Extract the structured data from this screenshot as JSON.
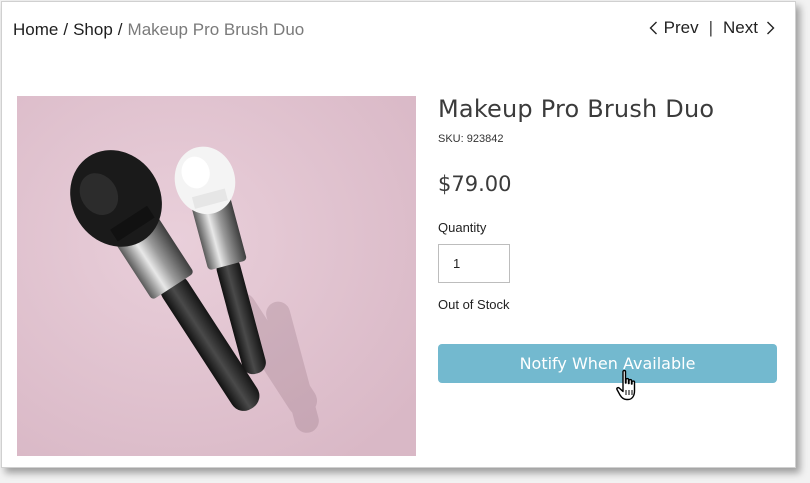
{
  "breadcrumb": {
    "home": "Home",
    "separator": "/",
    "shop": "Shop",
    "current": "Makeup Pro Brush Duo"
  },
  "pager": {
    "prev_label": "Prev",
    "divider": "|",
    "next_label": "Next"
  },
  "product": {
    "title": "Makeup Pro Brush Duo",
    "sku": "SKU: 923842",
    "price": "$79.00",
    "quantity_label": "Quantity",
    "quantity_value": "1",
    "stock_status": "Out of Stock",
    "notify_button_label": "Notify When Available",
    "image_icon": "makeup-brushes-photo"
  },
  "colors": {
    "button_bg": "#73b9cf",
    "image_bg": "#e2c5d1",
    "muted_text": "#7a7a7a"
  }
}
